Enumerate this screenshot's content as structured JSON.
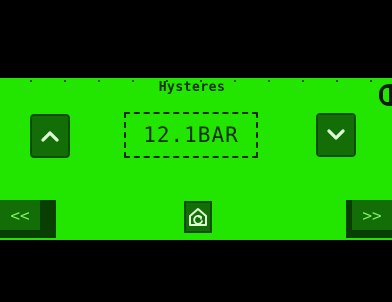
{
  "screen": {
    "title": "Hysteres",
    "value": "12.1BAR"
  },
  "buttons": {
    "increase_icon": "chevron-up-icon",
    "decrease_icon": "chevron-down-icon",
    "home_icon": "home-icon"
  },
  "nav": {
    "prev_label": "<<",
    "next_label": ">>"
  },
  "colors": {
    "background": "#000000",
    "panel": "#22e600",
    "button": "#136e08",
    "text_dark": "#0c2e06",
    "icon_light": "#7ff25d"
  }
}
